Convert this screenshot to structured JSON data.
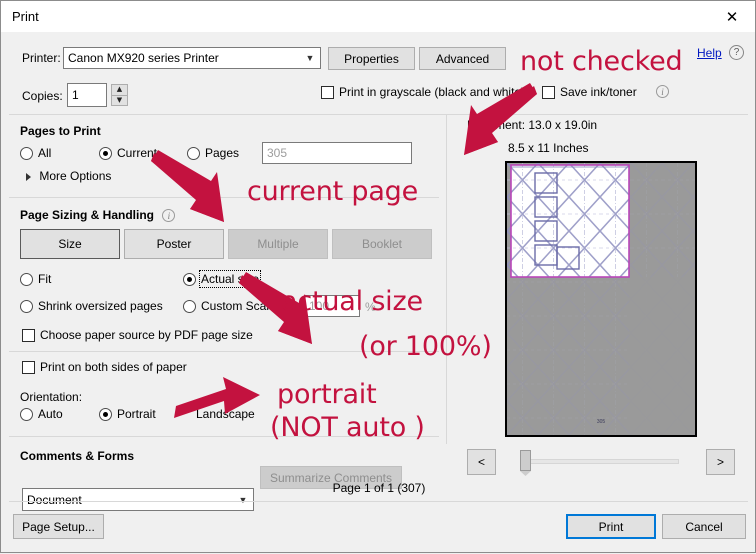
{
  "window": {
    "title": "Print",
    "close_icon": "close-icon"
  },
  "printer": {
    "label": "Printer:",
    "value": "Canon MX920 series Printer",
    "properties_label": "Properties",
    "advanced_label": "Advanced",
    "help_label": "Help",
    "help_icon": "question-mark-icon"
  },
  "copies": {
    "label": "Copies:",
    "value": "1",
    "spinner_up_icon": "chevron-up-icon",
    "spinner_down_icon": "chevron-down-icon"
  },
  "options": {
    "grayscale_label": "Print in grayscale (black and white)",
    "grayscale_checked": false,
    "save_ink_label": "Save ink/toner",
    "save_ink_checked": false,
    "info_icon": "info-icon"
  },
  "pages_to_print": {
    "heading": "Pages to Print",
    "all_label": "All",
    "current_label": "Current",
    "pages_label": "Pages",
    "selected": "Current",
    "pages_value": "305",
    "more_options_label": "More Options",
    "more_options_icon": "triangle-right-icon"
  },
  "page_sizing": {
    "heading": "Page Sizing & Handling",
    "info_icon": "info-icon",
    "buttons": [
      {
        "label": "Size",
        "enabled": true,
        "active": true
      },
      {
        "label": "Poster",
        "enabled": true,
        "active": false
      },
      {
        "label": "Multiple",
        "enabled": false,
        "active": false
      },
      {
        "label": "Booklet",
        "enabled": false,
        "active": false
      }
    ],
    "fit_label": "Fit",
    "actual_size_label": "Actual size",
    "shrink_label": "Shrink oversized pages",
    "custom_scale_label": "Custom Scale:",
    "selected": "Actual size",
    "scale_value": "100",
    "percent_label": "%",
    "paper_source_label": "Choose paper source by PDF page size",
    "paper_source_checked": false,
    "both_sides_label": "Print on both sides of paper",
    "both_sides_checked": false
  },
  "orientation": {
    "label": "Orientation:",
    "auto_label": "Auto",
    "portrait_label": "Portrait",
    "landscape_label": "Landscape",
    "selected": "Portrait"
  },
  "comments_forms": {
    "heading": "Comments & Forms",
    "value": "Document",
    "summarize_label": "Summarize Comments"
  },
  "preview": {
    "document_size": "Document: 13.0 x 19.0in",
    "paper_size": "8.5 x 11 Inches",
    "page_status": "Page 1 of 1 (307)",
    "prev_label": "<",
    "next_label": ">",
    "page_number_stamp": "305"
  },
  "footer": {
    "page_setup_label": "Page Setup...",
    "print_label": "Print",
    "cancel_label": "Cancel"
  },
  "annotations": {
    "color": "#c3123f",
    "not_checked": "not checked",
    "current_page": "current page",
    "actual_size": "actual size",
    "actual_size_2": "(or 100%)",
    "portrait": "portrait",
    "portrait_2": "(NOT auto )"
  }
}
